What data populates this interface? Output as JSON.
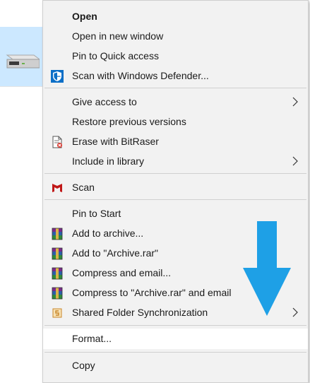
{
  "menu": {
    "items": [
      {
        "label": "Open"
      },
      {
        "label": "Open in new window"
      },
      {
        "label": "Pin to Quick access"
      },
      {
        "label": "Scan with Windows Defender...",
        "icon": "windows-defender-icon"
      },
      {
        "label": "Give access to",
        "submenu": true
      },
      {
        "label": "Restore previous versions"
      },
      {
        "label": "Erase with BitRaser",
        "icon": "bitraser-icon"
      },
      {
        "label": "Include in library",
        "submenu": true
      },
      {
        "label": "Scan",
        "icon": "mcafee-icon"
      },
      {
        "label": "Pin to Start"
      },
      {
        "label": "Add to archive...",
        "icon": "winrar-icon"
      },
      {
        "label": "Add to \"Archive.rar\"",
        "icon": "winrar-icon"
      },
      {
        "label": "Compress and email...",
        "icon": "winrar-icon"
      },
      {
        "label": "Compress to \"Archive.rar\" and email",
        "icon": "winrar-icon"
      },
      {
        "label": "Shared Folder Synchronization",
        "icon": "shared-folder-sync-icon",
        "submenu": true
      },
      {
        "label": "Format...",
        "highlighted": true
      },
      {
        "label": "Copy"
      }
    ]
  },
  "colors": {
    "menu_bg": "#f2f2f2",
    "highlight_bg": "#ffffff",
    "selected_drive_bg": "#cce8ff",
    "annotation_arrow": "#1ea0e6"
  }
}
